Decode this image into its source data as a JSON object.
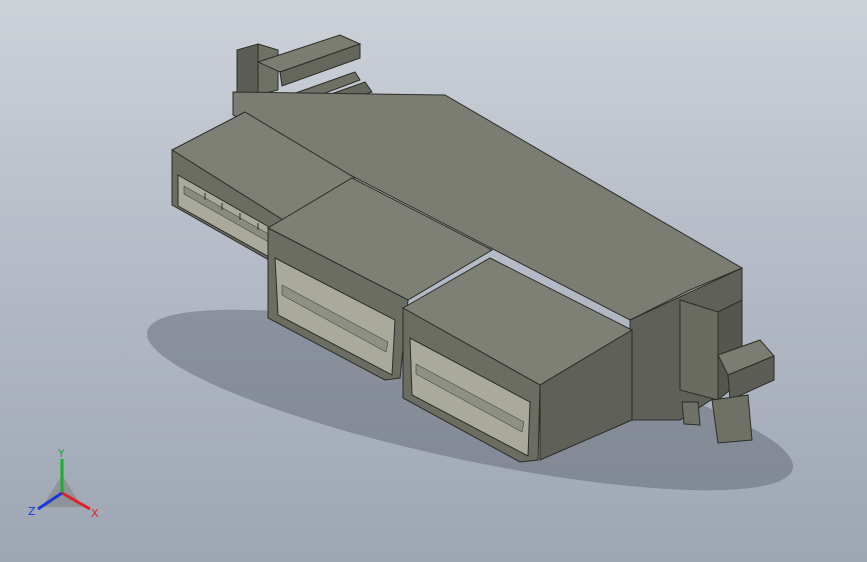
{
  "viewport": {
    "background_top": "#cdd2d9",
    "background_bottom": "#9ea6b3"
  },
  "model": {
    "component": "connector-3-port-housing",
    "color_top": "#7b7c72",
    "color_front": "#6b6c62",
    "color_side": "#5c5d54",
    "color_inner": "#a7a79a"
  },
  "triad": {
    "x_label": "X",
    "y_label": "Y",
    "z_label": "Z",
    "x_color": "#e0202a",
    "y_color": "#18b030",
    "z_color": "#1a3ad8"
  }
}
